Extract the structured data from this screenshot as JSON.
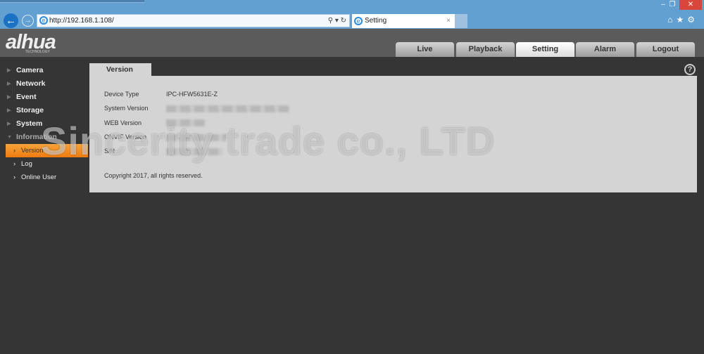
{
  "browser": {
    "url": "http://192.168.1.108/",
    "tab_title": "Setting",
    "tab_close": "×",
    "addr_tools": "⚲ ▾ ↻",
    "win_min": "–",
    "win_max": "❐",
    "win_close": "✕",
    "toolbar_icons": "⌂★⚙"
  },
  "header": {
    "logo": "alhua",
    "logo_sub": "TECHNOLOGY",
    "tabs": [
      {
        "label": "Live"
      },
      {
        "label": "Playback"
      },
      {
        "label": "Setting",
        "active": true
      },
      {
        "label": "Alarm"
      },
      {
        "label": "Logout"
      }
    ]
  },
  "sidebar": {
    "items": [
      {
        "label": "Camera"
      },
      {
        "label": "Network"
      },
      {
        "label": "Event"
      },
      {
        "label": "Storage"
      },
      {
        "label": "System"
      },
      {
        "label": "Information",
        "expanded": true
      }
    ],
    "subitems": [
      {
        "label": "Version",
        "active": true
      },
      {
        "label": "Log"
      },
      {
        "label": "Online User"
      }
    ]
  },
  "panel": {
    "tab": "Version",
    "help": "?",
    "rows": [
      {
        "label": "Device Type",
        "value": "IPC-HFW5631E-Z"
      },
      {
        "label": "System Version"
      },
      {
        "label": "WEB Version"
      },
      {
        "label": "ONVIF Version"
      },
      {
        "label": "S/N"
      }
    ],
    "copyright": "Copyright 2017, all rights reserved."
  },
  "watermark": "Sincerity trade co., LTD",
  "colors": {
    "accent": "#f08a1c",
    "browser": "#63a0d2",
    "header": "#5b5b5b",
    "background": "#353535"
  }
}
